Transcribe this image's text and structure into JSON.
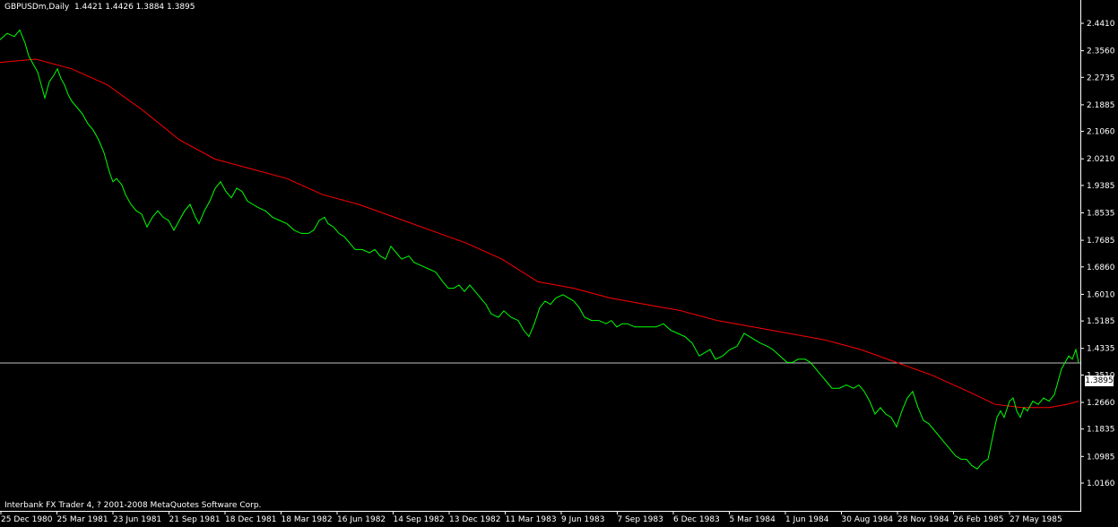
{
  "header": {
    "symbol_tf": "GBPUSDm,Daily",
    "ohlc": "1.4421 1.4426 1.3884 1.3895"
  },
  "footer": {
    "copyright": "Interbank FX Trader 4, ? 2001-2008 MetaQuotes Software Corp."
  },
  "current_price_label": "1.3895",
  "colors": {
    "background": "#000000",
    "price": "#00ff00",
    "ma": "#ff0000",
    "axis": "#ffffff",
    "current_line": "#c0c0c0"
  },
  "chart_data": {
    "type": "line",
    "title": "GBPUSDm,Daily",
    "ylim": [
      1.016,
      2.441
    ],
    "y_ticks": [
      "2.4410",
      "2.3560",
      "2.2735",
      "2.1885",
      "2.1060",
      "2.0210",
      "1.9385",
      "1.8535",
      "1.7685",
      "1.6860",
      "1.6010",
      "1.5185",
      "1.4335",
      "1.3510",
      "1.2660",
      "1.1835",
      "1.0985",
      "1.0160"
    ],
    "x_tick_labels": [
      "25 Dec 1980",
      "25 Mar 1981",
      "23 Jun 1981",
      "21 Sep 1981",
      "18 Dec 1981",
      "18 Mar 1982",
      "16 Jun 1982",
      "14 Sep 1982",
      "13 Dec 1982",
      "11 Mar 1983",
      "9 Jun 1983",
      "7 Sep 1983",
      "6 Dec 1983",
      "5 Mar 1984",
      "1 Jun 1984",
      "30 Aug 1984",
      "28 Nov 1984",
      "26 Feb 1985",
      "27 May 1985"
    ],
    "current_price": 1.3895,
    "series": [
      {
        "key": "price",
        "points": [
          [
            0,
            2.39
          ],
          [
            8,
            2.41
          ],
          [
            16,
            2.4
          ],
          [
            22,
            2.42
          ],
          [
            28,
            2.38
          ],
          [
            32,
            2.34
          ],
          [
            38,
            2.31
          ],
          [
            42,
            2.29
          ],
          [
            46,
            2.25
          ],
          [
            50,
            2.21
          ],
          [
            55,
            2.26
          ],
          [
            60,
            2.28
          ],
          [
            64,
            2.3
          ],
          [
            68,
            2.27
          ],
          [
            72,
            2.25
          ],
          [
            76,
            2.22
          ],
          [
            80,
            2.2
          ],
          [
            86,
            2.18
          ],
          [
            92,
            2.16
          ],
          [
            98,
            2.13
          ],
          [
            104,
            2.11
          ],
          [
            110,
            2.08
          ],
          [
            116,
            2.04
          ],
          [
            122,
            1.98
          ],
          [
            126,
            1.95
          ],
          [
            130,
            1.96
          ],
          [
            136,
            1.94
          ],
          [
            140,
            1.91
          ],
          [
            146,
            1.88
          ],
          [
            152,
            1.86
          ],
          [
            158,
            1.85
          ],
          [
            164,
            1.81
          ],
          [
            170,
            1.84
          ],
          [
            176,
            1.86
          ],
          [
            182,
            1.84
          ],
          [
            188,
            1.83
          ],
          [
            194,
            1.8
          ],
          [
            200,
            1.83
          ],
          [
            206,
            1.86
          ],
          [
            212,
            1.88
          ],
          [
            218,
            1.84
          ],
          [
            222,
            1.82
          ],
          [
            228,
            1.86
          ],
          [
            234,
            1.89
          ],
          [
            240,
            1.93
          ],
          [
            246,
            1.95
          ],
          [
            252,
            1.92
          ],
          [
            258,
            1.9
          ],
          [
            264,
            1.93
          ],
          [
            270,
            1.92
          ],
          [
            276,
            1.89
          ],
          [
            282,
            1.88
          ],
          [
            288,
            1.87
          ],
          [
            296,
            1.86
          ],
          [
            304,
            1.84
          ],
          [
            312,
            1.83
          ],
          [
            320,
            1.82
          ],
          [
            328,
            1.8
          ],
          [
            336,
            1.79
          ],
          [
            344,
            1.79
          ],
          [
            350,
            1.8
          ],
          [
            356,
            1.83
          ],
          [
            362,
            1.84
          ],
          [
            366,
            1.82
          ],
          [
            372,
            1.81
          ],
          [
            378,
            1.79
          ],
          [
            384,
            1.78
          ],
          [
            390,
            1.76
          ],
          [
            396,
            1.74
          ],
          [
            404,
            1.74
          ],
          [
            412,
            1.73
          ],
          [
            418,
            1.74
          ],
          [
            424,
            1.72
          ],
          [
            430,
            1.71
          ],
          [
            436,
            1.75
          ],
          [
            442,
            1.73
          ],
          [
            448,
            1.71
          ],
          [
            456,
            1.72
          ],
          [
            462,
            1.7
          ],
          [
            470,
            1.69
          ],
          [
            478,
            1.68
          ],
          [
            486,
            1.67
          ],
          [
            494,
            1.64
          ],
          [
            500,
            1.62
          ],
          [
            506,
            1.62
          ],
          [
            512,
            1.63
          ],
          [
            518,
            1.61
          ],
          [
            524,
            1.63
          ],
          [
            530,
            1.61
          ],
          [
            536,
            1.59
          ],
          [
            542,
            1.57
          ],
          [
            548,
            1.54
          ],
          [
            556,
            1.53
          ],
          [
            562,
            1.55
          ],
          [
            570,
            1.53
          ],
          [
            578,
            1.52
          ],
          [
            584,
            1.49
          ],
          [
            590,
            1.47
          ],
          [
            596,
            1.51
          ],
          [
            602,
            1.56
          ],
          [
            608,
            1.58
          ],
          [
            614,
            1.57
          ],
          [
            620,
            1.59
          ],
          [
            628,
            1.6
          ],
          [
            634,
            1.59
          ],
          [
            640,
            1.58
          ],
          [
            646,
            1.56
          ],
          [
            652,
            1.53
          ],
          [
            660,
            1.52
          ],
          [
            668,
            1.52
          ],
          [
            676,
            1.51
          ],
          [
            682,
            1.52
          ],
          [
            688,
            1.5
          ],
          [
            694,
            1.51
          ],
          [
            700,
            1.51
          ],
          [
            708,
            1.5
          ],
          [
            716,
            1.5
          ],
          [
            724,
            1.5
          ],
          [
            732,
            1.5
          ],
          [
            740,
            1.51
          ],
          [
            748,
            1.49
          ],
          [
            756,
            1.48
          ],
          [
            764,
            1.47
          ],
          [
            772,
            1.45
          ],
          [
            780,
            1.41
          ],
          [
            786,
            1.42
          ],
          [
            792,
            1.43
          ],
          [
            798,
            1.4
          ],
          [
            806,
            1.41
          ],
          [
            814,
            1.43
          ],
          [
            822,
            1.44
          ],
          [
            830,
            1.48
          ],
          [
            836,
            1.47
          ],
          [
            842,
            1.46
          ],
          [
            848,
            1.45
          ],
          [
            856,
            1.44
          ],
          [
            862,
            1.43
          ],
          [
            870,
            1.41
          ],
          [
            878,
            1.39
          ],
          [
            884,
            1.39
          ],
          [
            890,
            1.4
          ],
          [
            898,
            1.4
          ],
          [
            904,
            1.39
          ],
          [
            910,
            1.37
          ],
          [
            916,
            1.35
          ],
          [
            922,
            1.33
          ],
          [
            928,
            1.31
          ],
          [
            936,
            1.31
          ],
          [
            944,
            1.32
          ],
          [
            952,
            1.31
          ],
          [
            958,
            1.32
          ],
          [
            964,
            1.3
          ],
          [
            970,
            1.27
          ],
          [
            976,
            1.23
          ],
          [
            982,
            1.25
          ],
          [
            988,
            1.23
          ],
          [
            994,
            1.22
          ],
          [
            1000,
            1.19
          ],
          [
            1006,
            1.24
          ],
          [
            1012,
            1.28
          ],
          [
            1018,
            1.3
          ],
          [
            1024,
            1.25
          ],
          [
            1030,
            1.21
          ],
          [
            1036,
            1.2
          ],
          [
            1042,
            1.18
          ],
          [
            1048,
            1.16
          ],
          [
            1054,
            1.14
          ],
          [
            1060,
            1.12
          ],
          [
            1066,
            1.1
          ],
          [
            1072,
            1.09
          ],
          [
            1078,
            1.09
          ],
          [
            1084,
            1.07
          ],
          [
            1090,
            1.06
          ],
          [
            1096,
            1.08
          ],
          [
            1102,
            1.09
          ],
          [
            1108,
            1.17
          ],
          [
            1112,
            1.22
          ],
          [
            1116,
            1.24
          ],
          [
            1120,
            1.22
          ],
          [
            1126,
            1.27
          ],
          [
            1130,
            1.28
          ],
          [
            1134,
            1.24
          ],
          [
            1138,
            1.22
          ],
          [
            1142,
            1.25
          ],
          [
            1146,
            1.24
          ],
          [
            1152,
            1.27
          ],
          [
            1158,
            1.26
          ],
          [
            1164,
            1.28
          ],
          [
            1170,
            1.27
          ],
          [
            1176,
            1.29
          ],
          [
            1180,
            1.33
          ],
          [
            1184,
            1.37
          ],
          [
            1188,
            1.39
          ],
          [
            1192,
            1.41
          ],
          [
            1196,
            1.4
          ],
          [
            1200,
            1.43
          ],
          [
            1203,
            1.39
          ]
        ]
      },
      {
        "key": "ma",
        "points": [
          [
            0,
            2.32
          ],
          [
            40,
            2.33
          ],
          [
            80,
            2.3
          ],
          [
            120,
            2.25
          ],
          [
            160,
            2.17
          ],
          [
            200,
            2.08
          ],
          [
            240,
            2.02
          ],
          [
            280,
            1.99
          ],
          [
            320,
            1.96
          ],
          [
            360,
            1.91
          ],
          [
            400,
            1.88
          ],
          [
            440,
            1.84
          ],
          [
            480,
            1.8
          ],
          [
            520,
            1.76
          ],
          [
            560,
            1.71
          ],
          [
            600,
            1.64
          ],
          [
            640,
            1.62
          ],
          [
            680,
            1.59
          ],
          [
            720,
            1.57
          ],
          [
            760,
            1.55
          ],
          [
            800,
            1.52
          ],
          [
            840,
            1.5
          ],
          [
            880,
            1.48
          ],
          [
            920,
            1.46
          ],
          [
            960,
            1.43
          ],
          [
            1000,
            1.39
          ],
          [
            1040,
            1.35
          ],
          [
            1080,
            1.3
          ],
          [
            1110,
            1.26
          ],
          [
            1140,
            1.25
          ],
          [
            1170,
            1.25
          ],
          [
            1190,
            1.26
          ],
          [
            1203,
            1.27
          ]
        ]
      }
    ]
  }
}
